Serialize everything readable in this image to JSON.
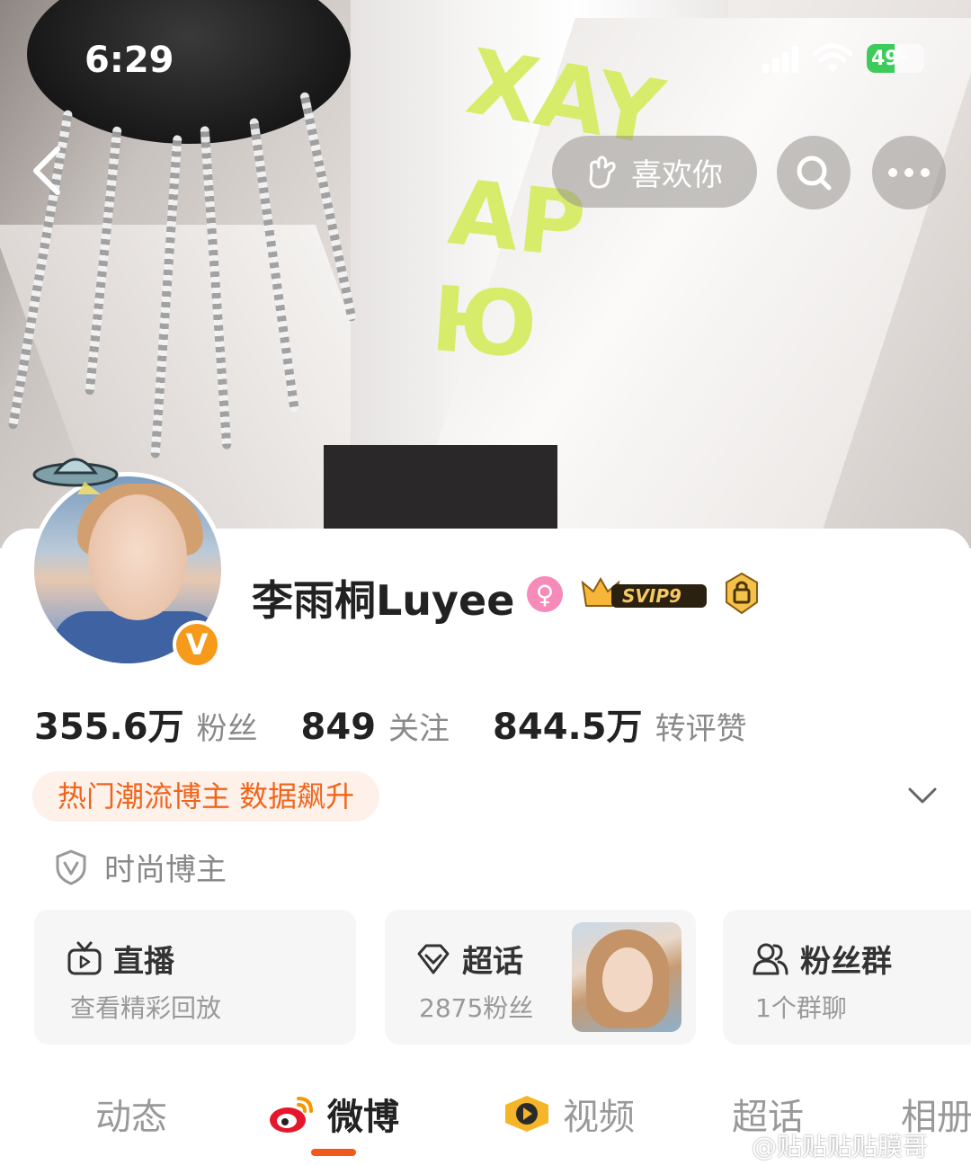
{
  "status_bar": {
    "time": "6:29",
    "battery": "49",
    "battery_level": 0.49
  },
  "nav": {
    "like_label": "喜欢你"
  },
  "cover_text": {
    "line1": "XAY",
    "line2": "AP",
    "line3": "Ю"
  },
  "profile": {
    "name": "李雨桐Luyee",
    "svip_label": "SVIP9",
    "verified_mark": "V"
  },
  "stats": [
    {
      "value": "355.6万",
      "label": "粉丝"
    },
    {
      "value": "849",
      "label": "关注"
    },
    {
      "value": "844.5万",
      "label": "转评赞"
    }
  ],
  "hot_tag": "热门潮流博主 数据飙升",
  "certification": "时尚博主",
  "tiles": {
    "live": {
      "title": "直播",
      "subtitle": "查看精彩回放"
    },
    "supertopic": {
      "title": "超话",
      "subtitle": "2875粉丝"
    },
    "fangroup": {
      "title": "粉丝群",
      "subtitle": "1个群聊"
    }
  },
  "tabs": [
    "动态",
    "微博",
    "视频",
    "超话",
    "相册"
  ],
  "active_tab": "微博",
  "watermark": "@贴贴贴贴膜哥",
  "colors": {
    "accent": "#F05A1A",
    "hot_tag_text": "#F0651C",
    "verified": "#F59A1B"
  }
}
